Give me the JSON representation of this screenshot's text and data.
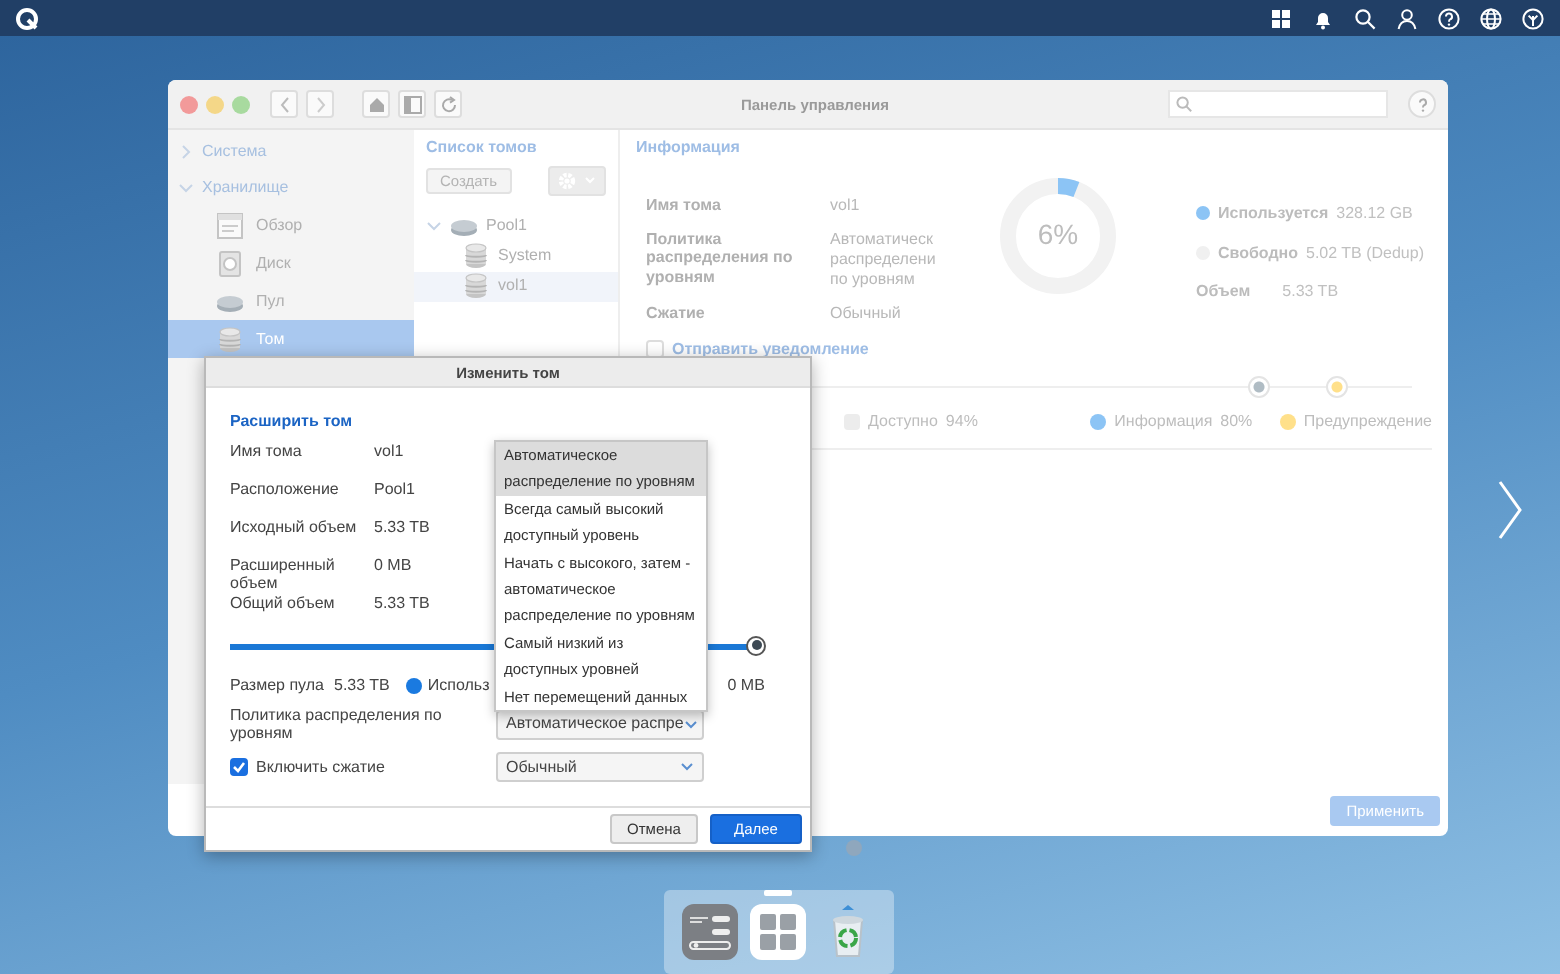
{
  "control_panel": {
    "title": "Панель управления",
    "sidebar": [
      {
        "label": "Система",
        "expanded": false
      },
      {
        "label": "Хранилище",
        "expanded": true,
        "children": [
          {
            "label": "Обзор",
            "kind": "overview",
            "selected": false
          },
          {
            "label": "Диск",
            "kind": "disk",
            "selected": false
          },
          {
            "label": "Пул",
            "kind": "pool",
            "selected": false
          },
          {
            "label": "Том",
            "kind": "volume",
            "selected": true
          }
        ]
      }
    ],
    "volume_list": {
      "title": "Список томов",
      "create_button": "Создать",
      "tree": [
        {
          "label": "Pool1",
          "expanded": true,
          "selected": false,
          "children": [
            {
              "label": "System",
              "selected": false
            },
            {
              "label": "vol1",
              "selected": true
            }
          ]
        }
      ]
    },
    "info": {
      "title": "Информация",
      "fields": [
        {
          "label": "Имя тома",
          "value": [
            "vol1"
          ]
        },
        {
          "label": "Политика распределения по уровням",
          "value": [
            "Автоматическ",
            "распределени",
            "по уровням"
          ]
        },
        {
          "label": "Сжатие",
          "value": [
            "Обычный"
          ]
        }
      ],
      "donut": {
        "level": 0.06,
        "label": "6%"
      },
      "legend": [
        {
          "label": "Используется",
          "value": "328.12 GB",
          "color": "#8cc4f5"
        },
        {
          "label": "Свободно",
          "value": "5.02 TB  (Dedup)",
          "color": "#f0f0f0"
        }
      ],
      "capacity": {
        "label": "Объем",
        "value": "5.33 TB"
      },
      "notify": {
        "label": "Отправить уведомление",
        "checked": false
      },
      "thresholds": [
        {
          "level": 0.8,
          "color": "#b0bcc4"
        },
        {
          "level": 0.9,
          "color": "#ffe08a"
        }
      ],
      "threshold_legend": [
        {
          "label": "Доступно",
          "value": "94%",
          "color": "#ececec"
        },
        {
          "label": "Информация",
          "value": "80%",
          "color": "#8cc4f5"
        },
        {
          "label": "Предупреждение",
          "color": "#ffe08a"
        }
      ]
    },
    "apply_button": {
      "label": "Применить",
      "disabled": true
    }
  },
  "dialog": {
    "title": "Изменить том",
    "section": "Расширить том",
    "fields": [
      {
        "label": "Имя тома",
        "value": "vol1"
      },
      {
        "label": "Расположение",
        "value": "Pool1"
      },
      {
        "label": "Исходный объем",
        "value": "5.33 TB"
      },
      {
        "label": "Расширенный объем",
        "value": "0 MB"
      },
      {
        "label": "Общий объем",
        "value": "5.33 TB"
      }
    ],
    "slider": {
      "level": 1
    },
    "pool_size": {
      "label": "Размер пула",
      "value": "5.33 TB"
    },
    "used": {
      "label": "Использ",
      "value": "0 MB",
      "color": "#1a7ae0"
    },
    "policy": {
      "label": "Политика распределения по уровням",
      "value": "Автоматическое распре",
      "options": [
        {
          "label": "Автоматическое распределение по уровням",
          "selected": true
        },
        {
          "label": "Всегда самый высокий доступный уровень",
          "selected": false
        },
        {
          "label": "Начать с высокого, затем - автоматическое распределение по уровням",
          "selected": false
        },
        {
          "label": "Самый низкий из доступных уровней",
          "selected": false
        },
        {
          "label": "Нет перемещений данных",
          "selected": false
        }
      ]
    },
    "compression": {
      "label": "Включить сжатие",
      "checked": true,
      "value": "Обычный"
    },
    "buttons": [
      {
        "label": "Отмена",
        "kind": "secondary"
      },
      {
        "label": "Далее",
        "kind": "primary"
      }
    ]
  },
  "dock": [
    {
      "kind": "storage",
      "active": false
    },
    {
      "kind": "apps",
      "active": true
    },
    {
      "kind": "trash",
      "active": false
    }
  ]
}
